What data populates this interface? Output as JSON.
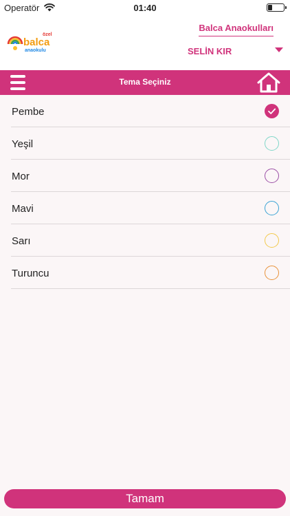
{
  "status_bar": {
    "carrier": "Operatör",
    "time": "01:40"
  },
  "header": {
    "logo": {
      "top_word": "özel",
      "main_word": "balca",
      "sub_word": "anaokulu"
    },
    "school_name": "Balca Anaokulları",
    "user_name": "SELİN KIR"
  },
  "nav": {
    "title": "Tema Seçiniz"
  },
  "themes": [
    {
      "label": "Pembe",
      "color": "#d0337b",
      "selected": true
    },
    {
      "label": "Yeşil",
      "color": "#7fd6c8",
      "selected": false
    },
    {
      "label": "Mor",
      "color": "#9b4fa6",
      "selected": false
    },
    {
      "label": "Mavi",
      "color": "#3aa3d4",
      "selected": false
    },
    {
      "label": "Sarı",
      "color": "#f2c94c",
      "selected": false
    },
    {
      "label": "Turuncu",
      "color": "#e8923a",
      "selected": false
    }
  ],
  "footer": {
    "done_label": "Tamam"
  },
  "colors": {
    "accent": "#d0337b"
  }
}
